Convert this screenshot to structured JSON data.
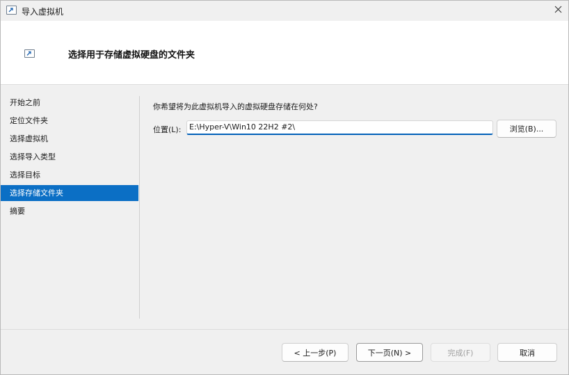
{
  "window": {
    "title": "导入虚拟机",
    "icon": "import-vm-icon",
    "close_icon": "close-icon"
  },
  "header": {
    "title": "选择用于存储虚拟硬盘的文件夹",
    "icon": "import-vm-icon"
  },
  "sidebar": {
    "items": [
      {
        "label": "开始之前",
        "active": false
      },
      {
        "label": "定位文件夹",
        "active": false
      },
      {
        "label": "选择虚拟机",
        "active": false
      },
      {
        "label": "选择导入类型",
        "active": false
      },
      {
        "label": "选择目标",
        "active": false
      },
      {
        "label": "选择存储文件夹",
        "active": true
      },
      {
        "label": "摘要",
        "active": false
      }
    ]
  },
  "content": {
    "question": "你希望将为此虚拟机导入的虚拟硬盘存储在何处?",
    "location_label": "位置(L):",
    "location_value": "E:\\Hyper-V\\Win10 22H2 #2\\",
    "browse_label": "浏览(B)..."
  },
  "footer": {
    "prev_label": "< 上一步(P)",
    "next_label": "下一页(N) >",
    "finish_label": "完成(F)",
    "cancel_label": "取消"
  },
  "colors": {
    "accent": "#0b6fc5",
    "input_focus": "#005fb8"
  }
}
